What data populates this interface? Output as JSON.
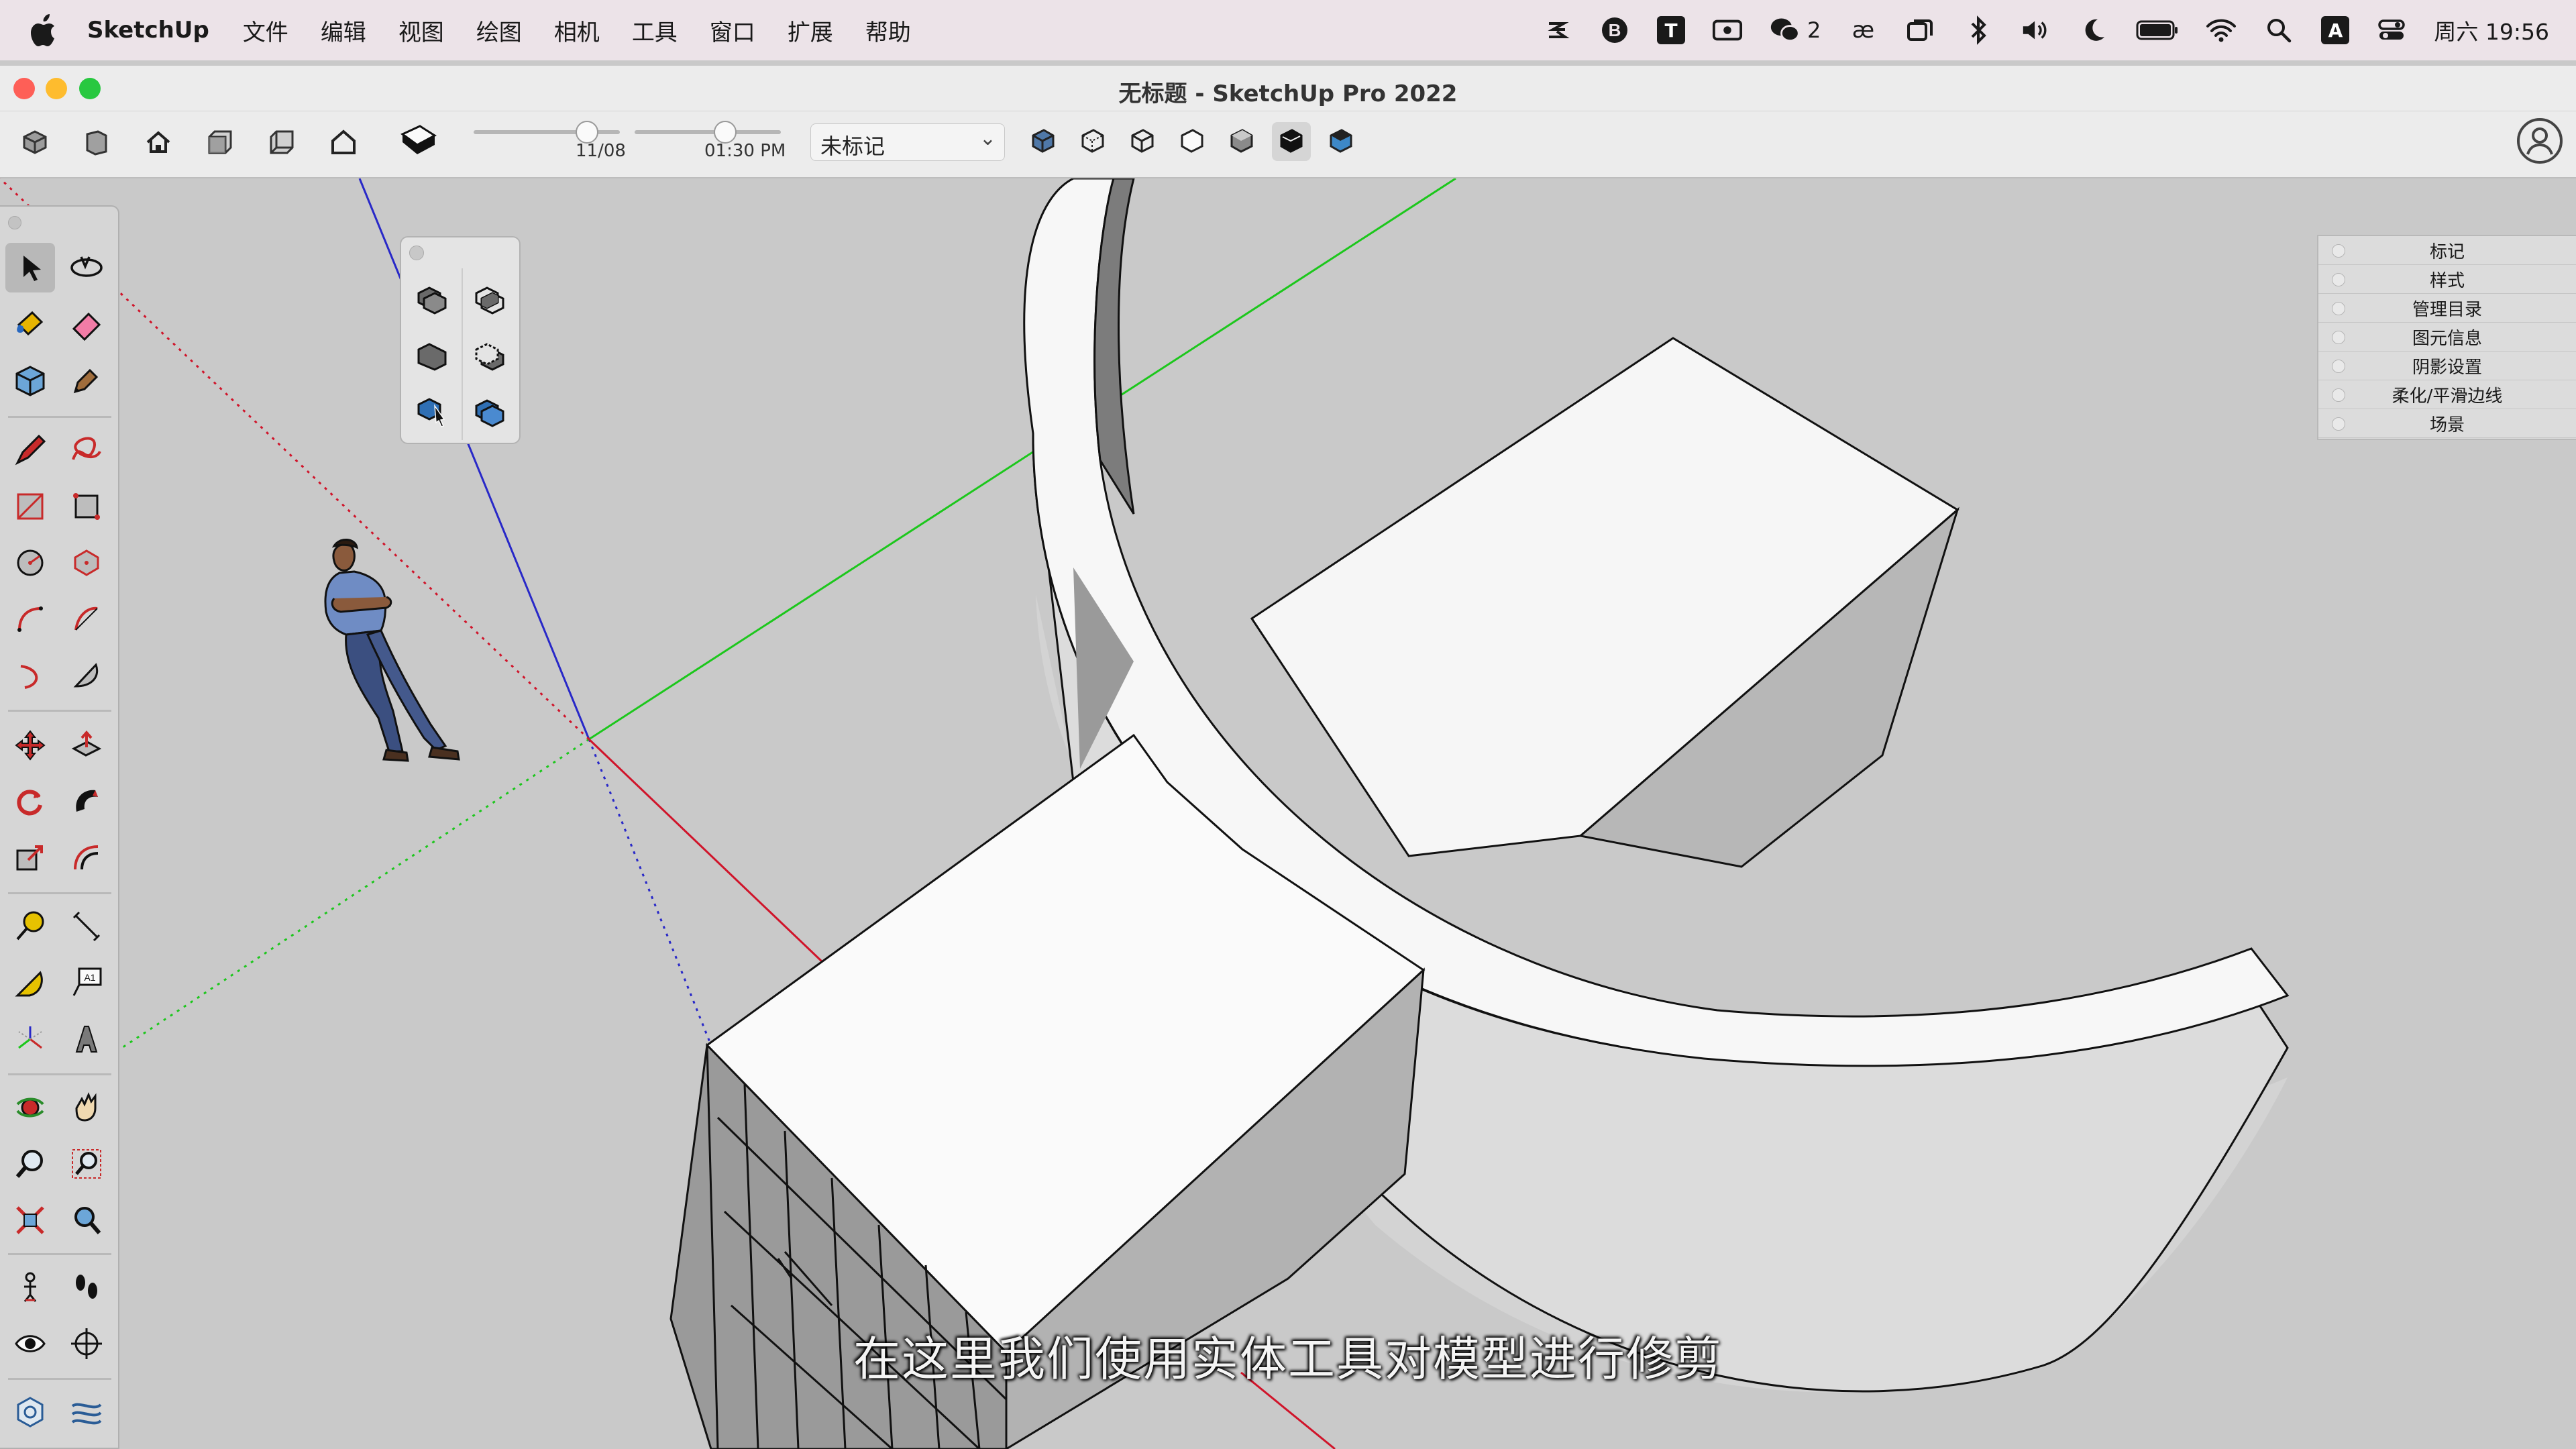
{
  "menubar": {
    "app_name": "SketchUp",
    "items": [
      "文件",
      "编辑",
      "视图",
      "绘图",
      "相机",
      "工具",
      "窗口",
      "扩展",
      "帮助"
    ],
    "status": {
      "wechat_count": "2",
      "input_badge": "A",
      "t_badge": "T",
      "clock": "周六 19:56"
    }
  },
  "window": {
    "title": "无标题 - SketchUp Pro 2022"
  },
  "toolbar": {
    "shadow_date": "11/08",
    "shadow_time": "01:30 PM",
    "tag_value": "未标记"
  },
  "tray": {
    "items": [
      "标记",
      "样式",
      "管理目录",
      "图元信息",
      "阴影设置",
      "柔化/平滑边线",
      "场景"
    ]
  },
  "subtitle": "在这里我们使用实体工具对模型进行修剪",
  "colors": {
    "axis_red": "#d0142a",
    "axis_green": "#1cc71c",
    "axis_blue": "#2828c8",
    "viewport_bg": "#c9c9c9",
    "face_light": "#f5f5f5",
    "face_shade": "#b4b4b4"
  }
}
